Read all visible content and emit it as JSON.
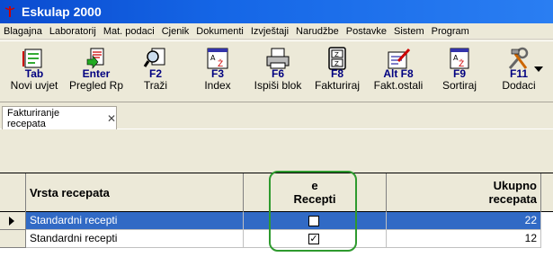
{
  "window": {
    "title": "Eskulap 2000"
  },
  "menu": [
    "Blagajna",
    "Laboratorij",
    "Mat. podaci",
    "Cjenik",
    "Dokumenti",
    "Izvještaji",
    "Narudžbe",
    "Postavke",
    "Sistem",
    "Program"
  ],
  "toolbar": {
    "buttons": [
      {
        "key": "Tab",
        "label": "Novi uvjet",
        "icon": "new-condition-icon"
      },
      {
        "key": "Enter",
        "label": "Pregled Rp",
        "icon": "preview-icon"
      },
      {
        "key": "F2",
        "label": "Traži",
        "icon": "search-icon"
      },
      {
        "key": "F3",
        "label": "Index",
        "icon": "index-icon"
      },
      {
        "key": "F6",
        "label": "Ispiši blok",
        "icon": "printer-icon"
      },
      {
        "key": "F8",
        "label": "Fakturiraj",
        "icon": "invoice-icon"
      },
      {
        "key": "Alt F8",
        "label": "Fakt.ostali",
        "icon": "invoice-other-icon"
      },
      {
        "key": "F9",
        "label": "Sortiraj",
        "icon": "sort-icon"
      },
      {
        "key": "F11",
        "label": "Dodaci",
        "icon": "tools-icon"
      }
    ]
  },
  "tabs": [
    {
      "label": "Fakturiranje recepata",
      "close": "✕"
    }
  ],
  "grid": {
    "columns": {
      "name": "Vrsta recepata",
      "erec_line1": "e",
      "erec_line2": "Recepti",
      "total_line1": "Ukupno",
      "total_line2": "recepata"
    },
    "rows": [
      {
        "name": "Standardni recepti",
        "erecept": false,
        "total": "22",
        "selected": true
      },
      {
        "name": "Standardni recepti",
        "erecept": true,
        "total": "12",
        "selected": false
      }
    ]
  },
  "colors": {
    "title_bar": "#1566e6",
    "selection": "#316ac5",
    "highlight": "#2e9a2e"
  }
}
